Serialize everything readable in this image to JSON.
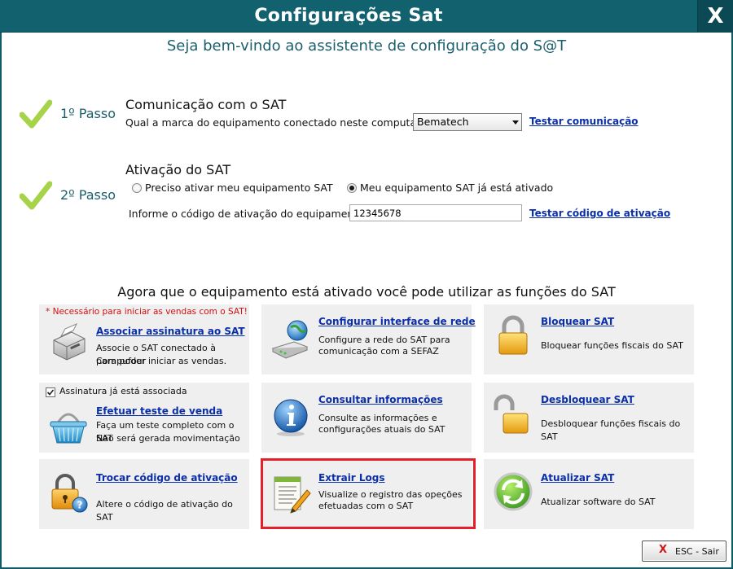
{
  "window": {
    "title": "Configurações Sat",
    "close_label": "X"
  },
  "welcome": "Seja bem-vindo ao assistente de configuração do S@T",
  "step1": {
    "label": "1º Passo",
    "heading": "Comunicação com o SAT",
    "question": "Qual a marca do equipamento conectado neste computador?",
    "brand_selected": "Bematech",
    "test_link": "Testar comunicação"
  },
  "step2": {
    "label": "2º Passo",
    "heading": "Ativação do SAT",
    "option_activate": "Preciso ativar meu equipamento SAT",
    "option_activated": "Meu equipamento SAT já está ativado",
    "selected_option": "option_activated",
    "code_label": "Informe o código de ativação do equipamento:",
    "code_value": "12345678",
    "test_link": "Testar código de ativação"
  },
  "functions": {
    "title": "Agora que o equipamento está ativado você pode utilizar as funções do SAT",
    "tiles": [
      {
        "note": "* Necessário para iniciar as vendas com o SAT!",
        "title": "Associar assinatura ao SAT",
        "desc": [
          "Associe o SAT conectado à Compufour",
          "para poder iniciar as vendas."
        ],
        "icon": "printer-icon"
      },
      {
        "title": "Configurar interface de rede",
        "desc": [
          "Configure a rede do SAT para",
          "comunicação com a SEFAZ"
        ],
        "icon": "network-icon"
      },
      {
        "title": "Bloquear SAT",
        "desc": [
          "Bloquear funções fiscais do SAT"
        ],
        "icon": "padlock-closed-icon"
      },
      {
        "checkbox_label": "Assinatura já está associada",
        "checkbox_checked": true,
        "title": "Efetuar teste de venda",
        "desc": [
          "Faça um teste completo com o SAT",
          "Não será gerada movimentação"
        ],
        "icon": "shopping-basket-icon"
      },
      {
        "title": "Consultar informações",
        "desc": [
          "Consulte as informações e",
          "configurações atuais do SAT"
        ],
        "icon": "info-icon"
      },
      {
        "title": "Desbloquear SAT",
        "desc": [
          "Desbloquear funções fiscais do SAT"
        ],
        "icon": "padlock-open-icon"
      },
      {
        "title": "Trocar código de ativação",
        "desc": [
          "Altere o código de ativação do SAT"
        ],
        "icon": "padlock-help-icon"
      },
      {
        "title": "Extrair Logs",
        "desc": [
          "Visualize o registro das opeções",
          "efetuadas com o SAT"
        ],
        "icon": "log-document-icon"
      },
      {
        "title": "Atualizar SAT",
        "desc": [
          "Atualizar software do SAT"
        ],
        "icon": "refresh-icon"
      }
    ]
  },
  "footer": {
    "esc_icon": "X",
    "esc_label": "ESC - Sair"
  },
  "colors": {
    "titlebar": "#11616f",
    "accent_text": "#1b5f6d",
    "link": "#0b2fa8",
    "check": "#a7d34a",
    "highlight": "#e5202a",
    "note": "#d01010"
  }
}
